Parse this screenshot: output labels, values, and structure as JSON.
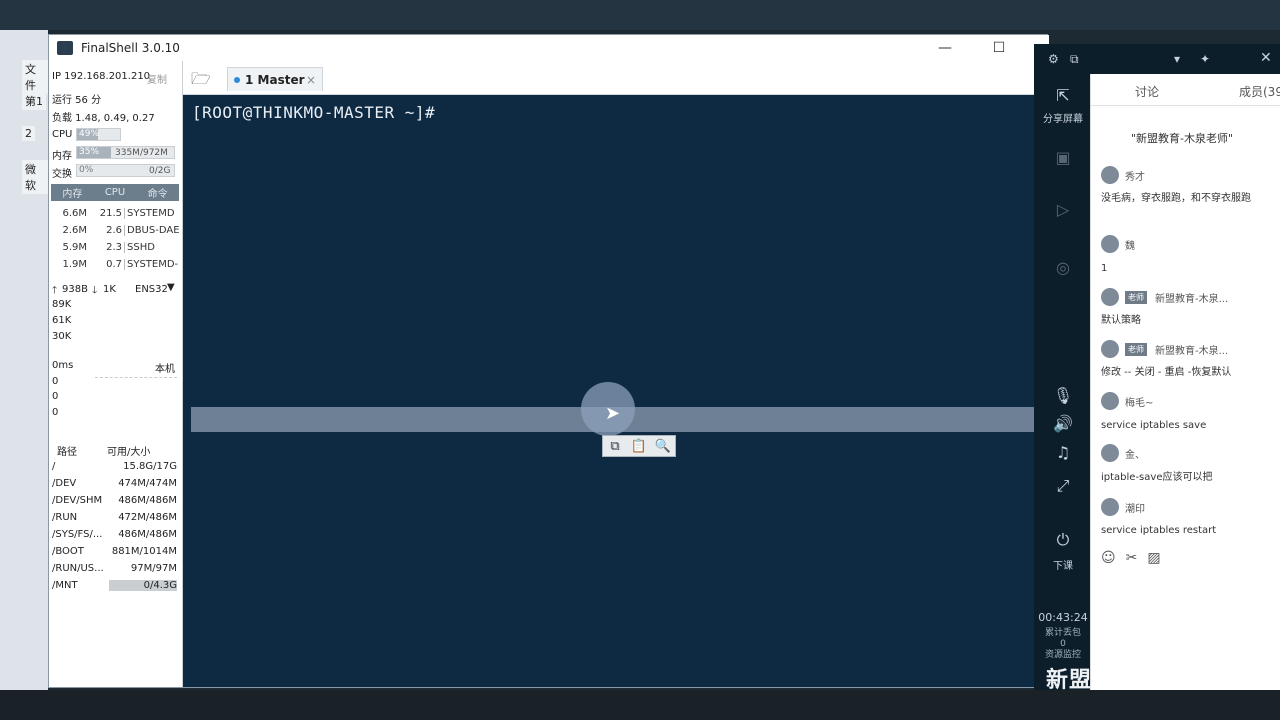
{
  "app": {
    "title": "FinalShell 3.0.10"
  },
  "bg_fragments": [
    "文件",
    "第1",
    "2",
    "微软"
  ],
  "server": {
    "ip_label": "IP 192.168.201.210",
    "copy": "复制",
    "uptime": "运行 56 分",
    "load": "负载 1.48, 0.49, 0.27",
    "cpu_label": "CPU",
    "cpu_value": "49%",
    "cpu_level": 0.49,
    "mem_label": "内存",
    "mem_value": "35%",
    "mem_level": 0.35,
    "mem_detail": "335M/972M",
    "swap_label": "交换",
    "swap_value": "0%",
    "swap_detail": "0/2G"
  },
  "process": {
    "headers": [
      "内存",
      "CPU",
      "命令"
    ],
    "rows": [
      {
        "mem": "6.6M",
        "cpu": "21.5",
        "cmd": "SYSTEMD"
      },
      {
        "mem": "2.6M",
        "cpu": "2.6",
        "cmd": "DBUS-DAE"
      },
      {
        "mem": "5.9M",
        "cpu": "2.3",
        "cmd": "SSHD"
      },
      {
        "mem": "1.9M",
        "cpu": "0.7",
        "cmd": "SYSTEMD-L"
      }
    ]
  },
  "network": {
    "up": "938B",
    "down": "1K",
    "iface": "ENS32",
    "scale": [
      "89K",
      "61K",
      "30K"
    ]
  },
  "ping": {
    "label": "0ms",
    "host": "本机",
    "values": [
      "0",
      "0",
      "0"
    ]
  },
  "disk": {
    "headers": [
      "路径",
      "可用/大小"
    ],
    "rows": [
      {
        "path": "/",
        "size": "15.8G/17G"
      },
      {
        "path": "/DEV",
        "size": "474M/474M"
      },
      {
        "path": "/DEV/SHM",
        "size": "486M/486M"
      },
      {
        "path": "/RUN",
        "size": "472M/486M"
      },
      {
        "path": "/SYS/FS/...",
        "size": "486M/486M"
      },
      {
        "path": "/BOOT",
        "size": "881M/1014M"
      },
      {
        "path": "/RUN/US...",
        "size": "97M/97M"
      },
      {
        "path": "/MNT",
        "size": "0/4.3G"
      }
    ]
  },
  "tabs": [
    {
      "label": "1 Master",
      "close": "×"
    }
  ],
  "terminal": {
    "prompt": "[ROOT@THINKMO-MASTER ~]#"
  },
  "classroom": {
    "share_label": "分享屏幕",
    "sidebar_labels": [
      "",
      "",
      "",
      "下课"
    ],
    "timer": "00:43:24",
    "stats": [
      "累计丢包",
      "0",
      "资源监控"
    ],
    "chat_tab": "讨论",
    "members_tab": "成员(39",
    "banner": "\"新盟教育-木泉老师\"",
    "messages": [
      {
        "name": "秀才",
        "text": "没毛病，穿衣服跑，和不穿衣服跑"
      },
      {
        "name": "魏",
        "text": "1"
      },
      {
        "name": "新盟教育-木泉...",
        "badge": "老师",
        "text": "默认策略"
      },
      {
        "name": "新盟教育-木泉...",
        "badge": "老师",
        "text": "修改 -- 关闭 - 重启 -恢复默认"
      },
      {
        "name": "梅毛~",
        "text": "service iptables save"
      },
      {
        "name": "金、",
        "text": "iptable-save应该可以把"
      },
      {
        "name": "潮印",
        "text": "service iptables restart"
      }
    ],
    "watermark": "新盟"
  }
}
